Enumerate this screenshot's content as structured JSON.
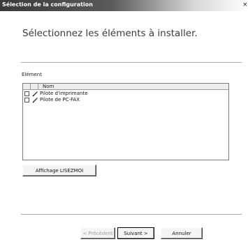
{
  "window": {
    "title": "Sélection de la configuration",
    "close_glyph": "×"
  },
  "heading": "Sélectionnez les éléments à installer.",
  "group_label": "Elément",
  "list": {
    "column_name": "Nom",
    "items": [
      {
        "label": "Pilote d'imprimante",
        "checked": false,
        "icon": "pen-icon"
      },
      {
        "label": "Pilote de PC-FAX",
        "checked": false,
        "icon": "pen-icon"
      }
    ]
  },
  "buttons": {
    "readme": "Affichage LISEZMOI",
    "prev": "< Précédent",
    "next": "Suivant >",
    "cancel": "Annuler"
  }
}
